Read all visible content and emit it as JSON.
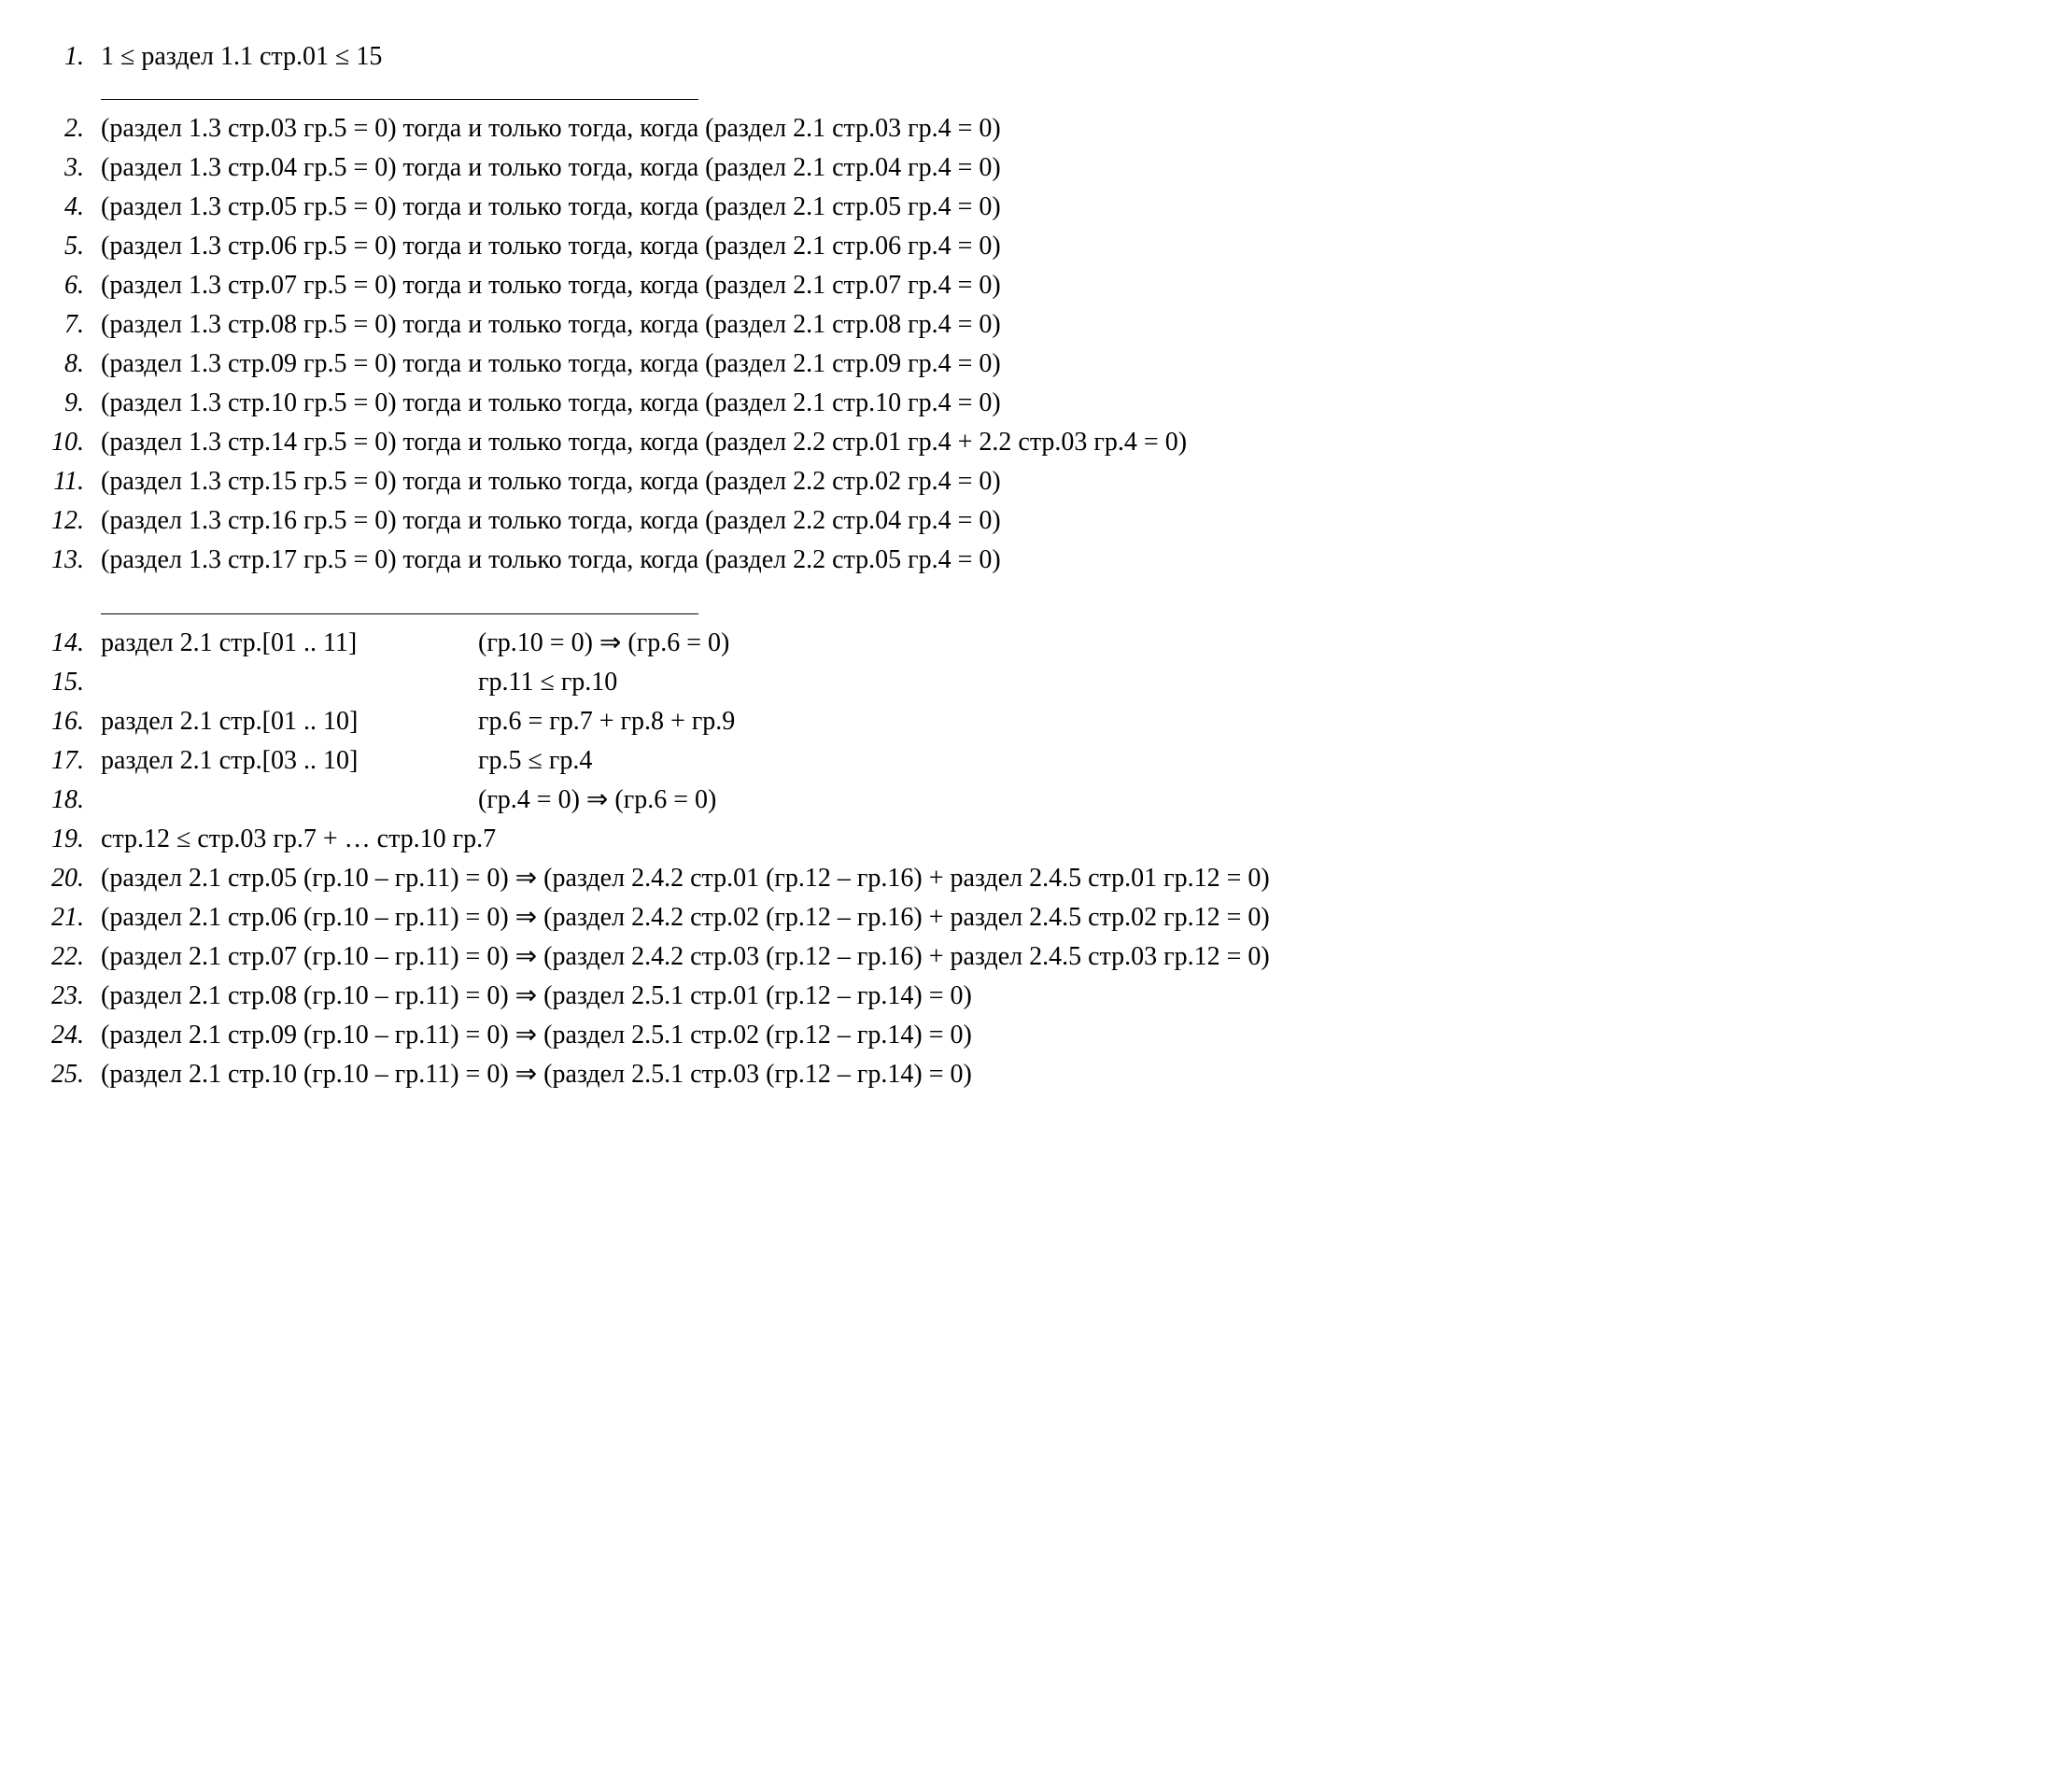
{
  "items": [
    {
      "n": "1.",
      "text": "1 ≤ раздел 1.1 стр.01 ≤ 15"
    },
    {
      "n": "2.",
      "text": "(раздел 1.3 стр.03 гр.5 = 0) тогда и только тогда, когда (раздел 2.1 стр.03 гр.4 = 0)"
    },
    {
      "n": "3.",
      "text": "(раздел 1.3 стр.04 гр.5 = 0) тогда и только тогда, когда (раздел 2.1 стр.04 гр.4 = 0)"
    },
    {
      "n": "4.",
      "text": "(раздел 1.3 стр.05 гр.5 = 0) тогда и только тогда, когда (раздел 2.1 стр.05 гр.4 = 0)"
    },
    {
      "n": "5.",
      "text": "(раздел 1.3 стр.06 гр.5 = 0) тогда и только тогда, когда (раздел 2.1 стр.06 гр.4 = 0)"
    },
    {
      "n": "6.",
      "text": "(раздел 1.3 стр.07 гр.5 = 0) тогда и только тогда, когда (раздел 2.1 стр.07 гр.4 = 0)"
    },
    {
      "n": "7.",
      "text": "(раздел 1.3 стр.08 гр.5 = 0) тогда и только тогда, когда (раздел 2.1 стр.08 гр.4 = 0)"
    },
    {
      "n": "8.",
      "text": "(раздел 1.3 стр.09 гр.5 = 0) тогда и только тогда, когда (раздел 2.1 стр.09 гр.4 = 0)"
    },
    {
      "n": "9.",
      "text": "(раздел 1.3 стр.10 гр.5 = 0) тогда и только тогда, когда (раздел 2.1 стр.10 гр.4 = 0)"
    },
    {
      "n": "10.",
      "text": "(раздел 1.3 стр.14 гр.5 = 0) тогда и только тогда, когда (раздел 2.2 стр.01 гр.4 + 2.2 стр.03 гр.4 = 0)"
    },
    {
      "n": "11.",
      "text": "(раздел 1.3 стр.15 гр.5 = 0) тогда и только тогда, когда (раздел 2.2 стр.02 гр.4 = 0)"
    },
    {
      "n": "12.",
      "text": "(раздел 1.3 стр.16 гр.5 = 0) тогда и только тогда, когда (раздел 2.2 стр.04 гр.4 = 0)"
    },
    {
      "n": "13.",
      "text": "(раздел 1.3 стр.17 гр.5 = 0) тогда и только тогда, когда (раздел 2.2 стр.05 гр.4 = 0)"
    },
    {
      "n": "14.",
      "label": "раздел 2.1 стр.[01 .. 11]",
      "expr": "(гр.10 = 0) ⇒ (гр.6 = 0)"
    },
    {
      "n": "15.",
      "label": "",
      "expr": "гр.11 ≤ гр.10"
    },
    {
      "n": "16.",
      "label": "раздел 2.1 стр.[01 .. 10]",
      "expr": "гр.6 = гр.7 + гр.8 + гр.9"
    },
    {
      "n": "17.",
      "label": "раздел 2.1 стр.[03 .. 10]",
      "expr": "гр.5 ≤ гр.4"
    },
    {
      "n": "18.",
      "label": "",
      "expr": "(гр.4 = 0) ⇒ (гр.6 = 0)"
    },
    {
      "n": "19.",
      "text": "стр.12 ≤ стр.03 гр.7 + … стр.10 гр.7"
    },
    {
      "n": "20.",
      "text": "(раздел 2.1 стр.05 (гр.10 – гр.11) = 0) ⇒ (раздел 2.4.2 стр.01 (гр.12 – гр.16) + раздел 2.4.5 стр.01 гр.12 = 0)"
    },
    {
      "n": "21.",
      "text": "(раздел 2.1 стр.06 (гр.10 – гр.11) = 0) ⇒ (раздел 2.4.2 стр.02 (гр.12 – гр.16) + раздел 2.4.5 стр.02 гр.12 = 0)"
    },
    {
      "n": "22.",
      "text": "(раздел 2.1 стр.07 (гр.10 – гр.11) = 0) ⇒ (раздел 2.4.2 стр.03 (гр.12 – гр.16) + раздел 2.4.5 стр.03 гр.12 = 0)"
    },
    {
      "n": "23.",
      "text": "(раздел 2.1 стр.08 (гр.10 – гр.11) = 0) ⇒ (раздел 2.5.1 стр.01 (гр.12 – гр.14) = 0)"
    },
    {
      "n": "24.",
      "text": "(раздел 2.1 стр.09 (гр.10 – гр.11) = 0) ⇒ (раздел 2.5.1 стр.02 (гр.12 – гр.14) = 0)"
    },
    {
      "n": "25.",
      "text": "(раздел 2.1 стр.10 (гр.10 – гр.11) = 0) ⇒ (раздел 2.5.1 стр.03 (гр.12 – гр.14) = 0)"
    }
  ]
}
